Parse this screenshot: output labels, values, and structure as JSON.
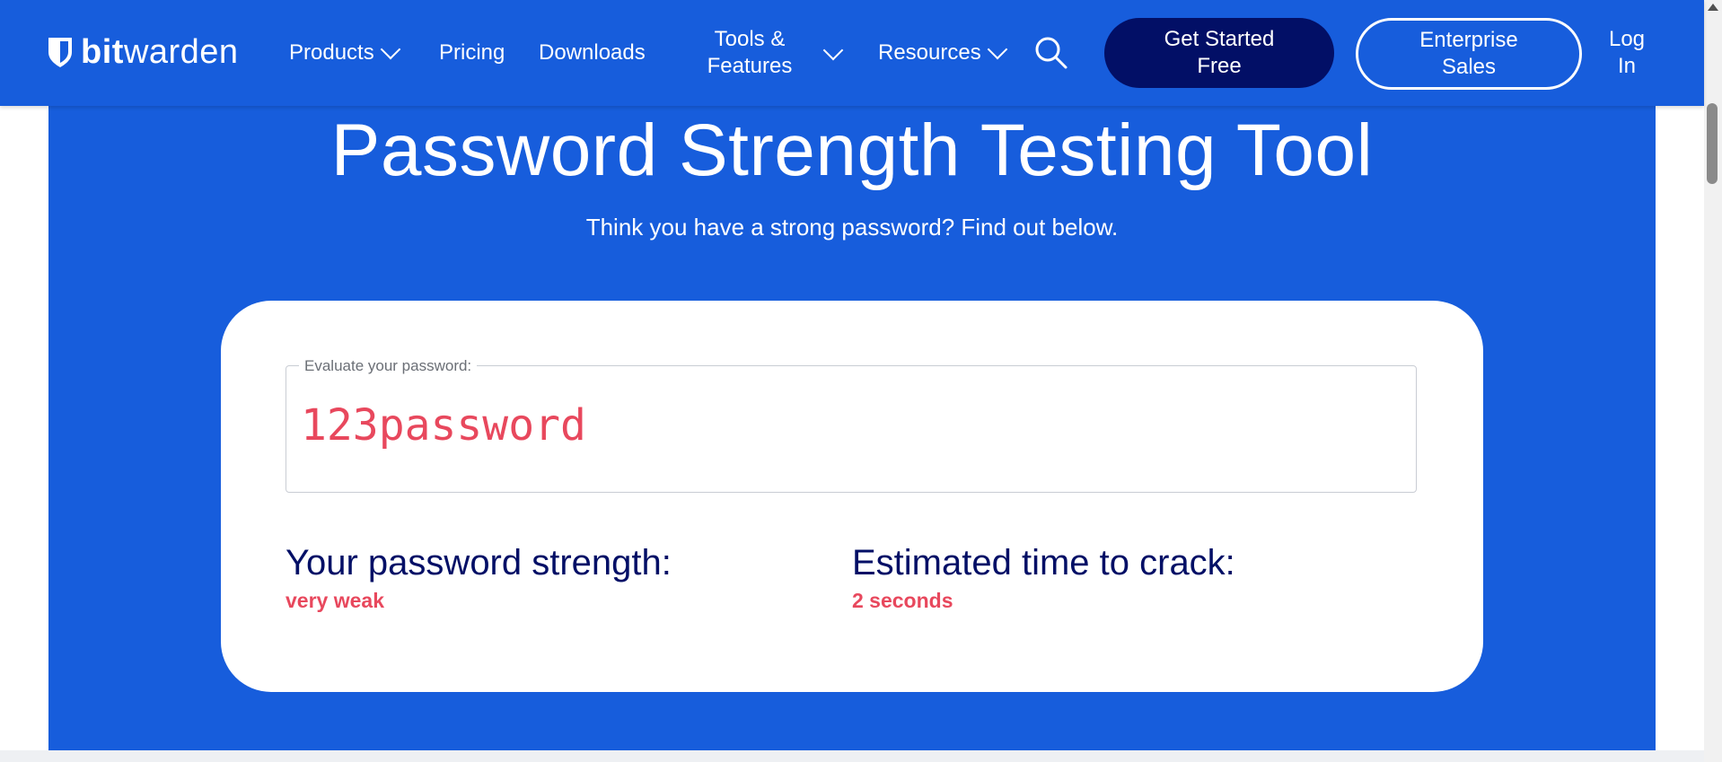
{
  "nav": {
    "logo_bold": "bit",
    "logo_light": "warden",
    "products": "Products",
    "pricing": "Pricing",
    "downloads": "Downloads",
    "tools_line1": "Tools &",
    "tools_line2": "Features",
    "resources": "Resources",
    "get_started_line1": "Get Started",
    "get_started_line2": "Free",
    "enterprise_line1": "Enterprise",
    "enterprise_line2": "Sales",
    "login_line1": "Log",
    "login_line2": "In"
  },
  "hero": {
    "title": "Password Strength Testing Tool",
    "subtitle": "Think you have a strong password? Find out below."
  },
  "evaluator": {
    "field_label": "Evaluate your password:",
    "password_value": "123password",
    "strength_label": "Your password strength:",
    "strength_value": "very weak",
    "crack_label": "Estimated time to crack:",
    "crack_value": "2 seconds"
  },
  "colors": {
    "brand_blue": "#175ddc",
    "navy": "#020f66",
    "danger_red": "#e8485d"
  }
}
